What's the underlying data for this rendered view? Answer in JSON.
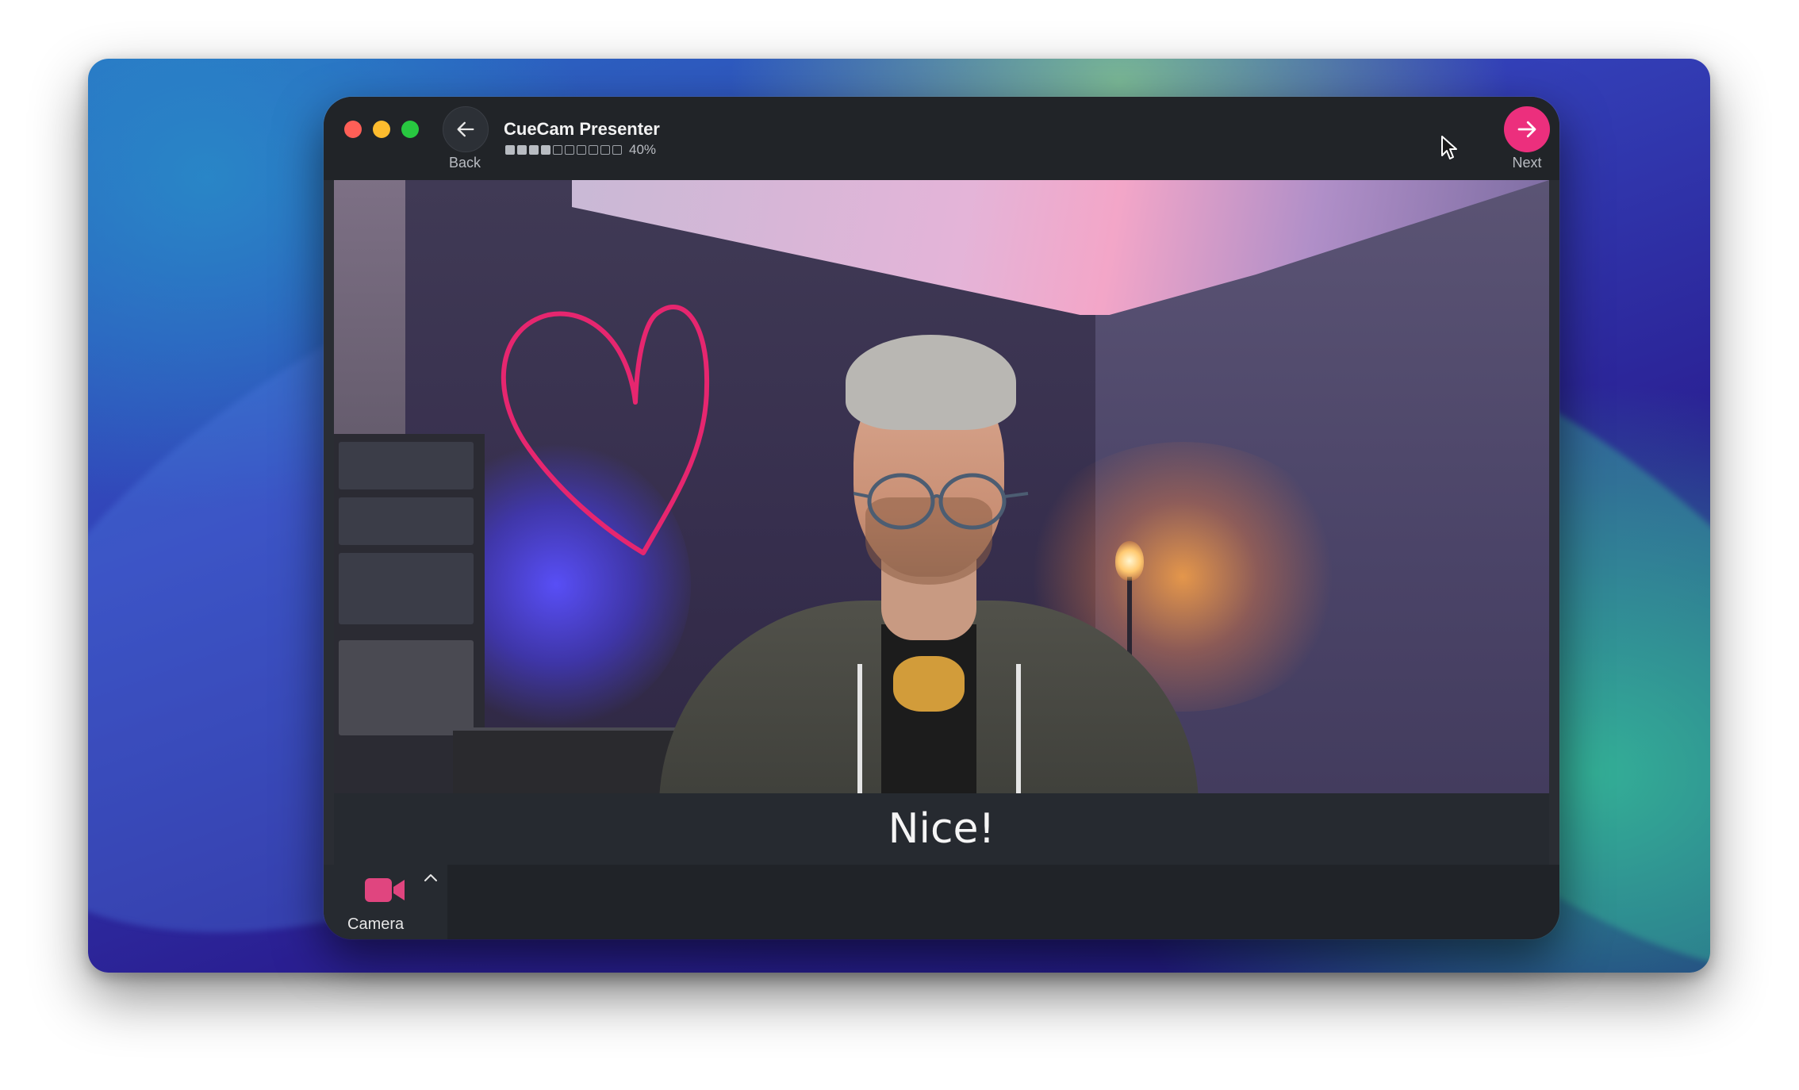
{
  "window": {
    "title": "CueCam Presenter",
    "progress_percent_label": "40%",
    "progress_segments_total": 10,
    "progress_segments_filled": 4
  },
  "navigation": {
    "back_label": "Back",
    "next_label": "Next"
  },
  "caption": {
    "text": "Nice!"
  },
  "bottom_bar": {
    "camera_label": "Camera"
  },
  "icons": {
    "back": "arrow-left-icon",
    "next": "arrow-right-icon",
    "camera": "video-camera-icon",
    "menu": "chevron-up-icon"
  },
  "colors": {
    "accent": "#ec2f7d",
    "window_bg": "#2a2d33",
    "titlebar_bg": "#212428",
    "close": "#ff5f57",
    "minimize": "#febc2e",
    "zoom": "#28c840"
  }
}
